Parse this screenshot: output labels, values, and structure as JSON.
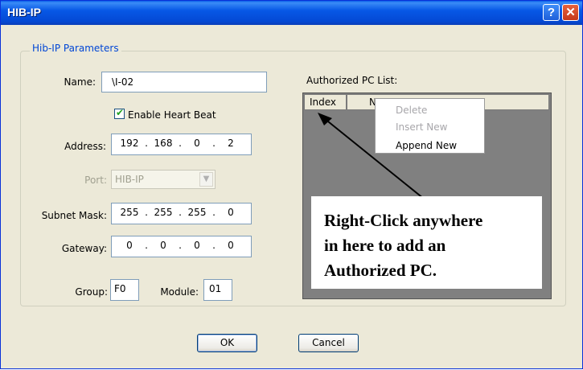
{
  "window": {
    "title": "HIB-IP",
    "help_glyph": "?",
    "close_glyph": "✕"
  },
  "group": {
    "label": "Hib-IP Parameters"
  },
  "form": {
    "name_label": "Name:",
    "name_value": "\\I-02",
    "heartbeat_label": "Enable Heart Beat",
    "heartbeat_checked": true,
    "address_label": "Address:",
    "address": [
      "192",
      "168",
      "0",
      "2"
    ],
    "port_label": "Port:",
    "port_value": "HIB-IP",
    "subnet_label": "Subnet Mask:",
    "subnet": [
      "255",
      "255",
      "255",
      "0"
    ],
    "gateway_label": "Gateway:",
    "gateway": [
      "0",
      "0",
      "0",
      "0"
    ],
    "group_label": "Group:",
    "group_value": "F0",
    "module_label": "Module:",
    "module_value": "01"
  },
  "pc_list": {
    "label": "Authorized PC List:",
    "columns": [
      "Index",
      "Na"
    ]
  },
  "context_menu": {
    "items": [
      "Delete",
      "Insert New",
      "Append New"
    ],
    "enabled": [
      false,
      false,
      true
    ]
  },
  "annotation": {
    "lines": [
      "Right-Click anywhere",
      "in here to add an",
      "Authorized PC."
    ]
  },
  "buttons": {
    "ok": "OK",
    "cancel": "Cancel"
  },
  "icons": {
    "help": "help-icon",
    "close": "close-icon",
    "check": "check-icon",
    "dropdown": "chevron-down-icon"
  }
}
